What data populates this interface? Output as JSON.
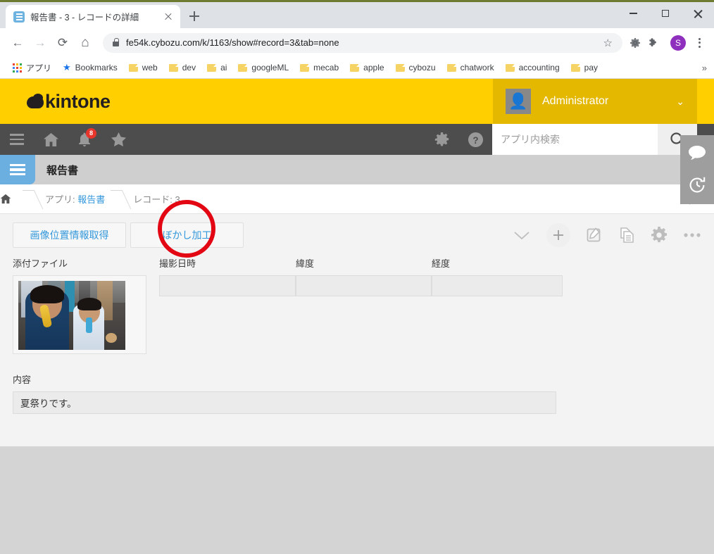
{
  "browser": {
    "tab": {
      "title": "報告書 - 3 - レコードの詳細",
      "favicon": "list-icon",
      "close": "×"
    },
    "newtab_label": "+",
    "window_controls": {
      "minimize": "minimize-icon",
      "maximize": "maximize-icon",
      "close": "close-icon"
    },
    "nav": {
      "back": "←",
      "forward": "→",
      "reload": "⟳",
      "home": "⌂"
    },
    "omnibox": {
      "url": "fe54k.cybozu.com/k/1163/show#record=3&tab=none",
      "lock": "lock-icon",
      "star": "☆"
    },
    "extensions": {
      "gear": "⚙",
      "puzzle": "🧩"
    },
    "profile_initial": "S",
    "bookmarks": [
      {
        "label": "アプリ",
        "icon": "apps-grid-icon"
      },
      {
        "label": "Bookmarks",
        "icon": "star-icon"
      },
      {
        "label": "web",
        "icon": "folder-icon"
      },
      {
        "label": "dev",
        "icon": "folder-icon"
      },
      {
        "label": "ai",
        "icon": "folder-icon"
      },
      {
        "label": "googleML",
        "icon": "folder-icon"
      },
      {
        "label": "mecab",
        "icon": "folder-icon"
      },
      {
        "label": "apple",
        "icon": "folder-icon"
      },
      {
        "label": "cybozu",
        "icon": "folder-icon"
      },
      {
        "label": "chatwork",
        "icon": "folder-icon"
      },
      {
        "label": "accounting",
        "icon": "folder-icon"
      },
      {
        "label": "pay",
        "icon": "folder-icon"
      }
    ],
    "bookmarks_overflow": "»"
  },
  "kintone": {
    "brand": "kintone",
    "user": {
      "name": "Administrator",
      "caret": "⌄",
      "avatar": "user-avatar-icon"
    },
    "nav_icons": [
      {
        "name": "menu-icon"
      },
      {
        "name": "home-icon"
      },
      {
        "name": "bell-icon",
        "badge": "8"
      },
      {
        "name": "star-icon"
      },
      {
        "name": "gear-icon"
      },
      {
        "name": "help-icon"
      }
    ],
    "search": {
      "placeholder": "アプリ内検索",
      "button": "search-icon"
    },
    "app": {
      "name": "報告書",
      "icon": "app-list-icon"
    },
    "breadcrumb": {
      "home": "⌂",
      "app_prefix": "アプリ:",
      "app_name": "報告書",
      "record": "レコード: 3",
      "pin": "pin-icon"
    },
    "action_buttons": [
      {
        "label": "画像位置情報取得"
      },
      {
        "label": "ぼかし加工",
        "highlighted": true
      }
    ],
    "tools": [
      {
        "name": "chevron-down-icon"
      },
      {
        "name": "add-record-icon"
      },
      {
        "name": "edit-record-icon"
      },
      {
        "name": "duplicate-record-icon"
      },
      {
        "name": "settings-gear-icon"
      },
      {
        "name": "more-options-icon"
      }
    ],
    "fields": {
      "attachment": {
        "label": "添付ファイル",
        "image_alt": "summer-festival-children-photo"
      },
      "shot_datetime": {
        "label": "撮影日時",
        "value": ""
      },
      "latitude": {
        "label": "緯度",
        "value": ""
      },
      "longitude": {
        "label": "経度",
        "value": ""
      },
      "content": {
        "label": "内容",
        "value": "夏祭りです。"
      }
    },
    "side_tabs": [
      {
        "name": "comment-icon"
      },
      {
        "name": "history-icon"
      }
    ],
    "colors": {
      "brand_yellow": "#ffcf00",
      "user_yellow": "#e5b800",
      "nav_dark": "#4d4d4d",
      "link_blue": "#3498db",
      "annotation_red": "#e30613"
    }
  }
}
